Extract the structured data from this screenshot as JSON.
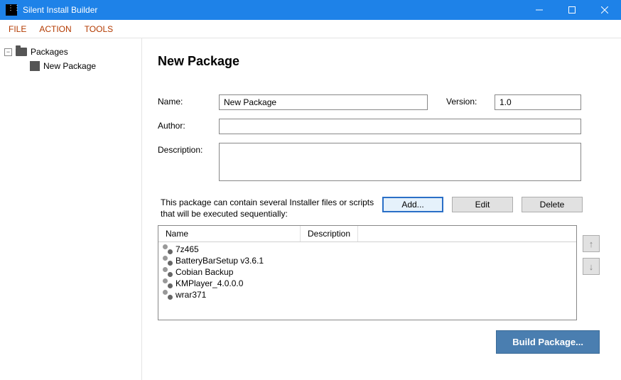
{
  "window": {
    "title": "Silent Install Builder"
  },
  "menu": {
    "file": "FILE",
    "action": "ACTION",
    "tools": "TOOLS"
  },
  "tree": {
    "root": "Packages",
    "child": "New Package"
  },
  "page": {
    "title": "New Package"
  },
  "form": {
    "name_label": "Name:",
    "name_value": "New Package",
    "version_label": "Version:",
    "version_value": "1.0",
    "author_label": "Author:",
    "author_value": "",
    "description_label": "Description:",
    "description_value": ""
  },
  "hint": "This package can contain several Installer files or scripts that will be executed sequentially:",
  "buttons": {
    "add": "Add...",
    "edit": "Edit",
    "delete": "Delete",
    "build": "Build Package..."
  },
  "list": {
    "headers": {
      "name": "Name",
      "description": "Description"
    },
    "items": [
      {
        "name": "7z465",
        "desc": ""
      },
      {
        "name": "BatteryBarSetup v3.6.1",
        "desc": ""
      },
      {
        "name": "Cobian Backup",
        "desc": ""
      },
      {
        "name": "KMPlayer_4.0.0.0",
        "desc": ""
      },
      {
        "name": "wrar371",
        "desc": ""
      }
    ]
  }
}
